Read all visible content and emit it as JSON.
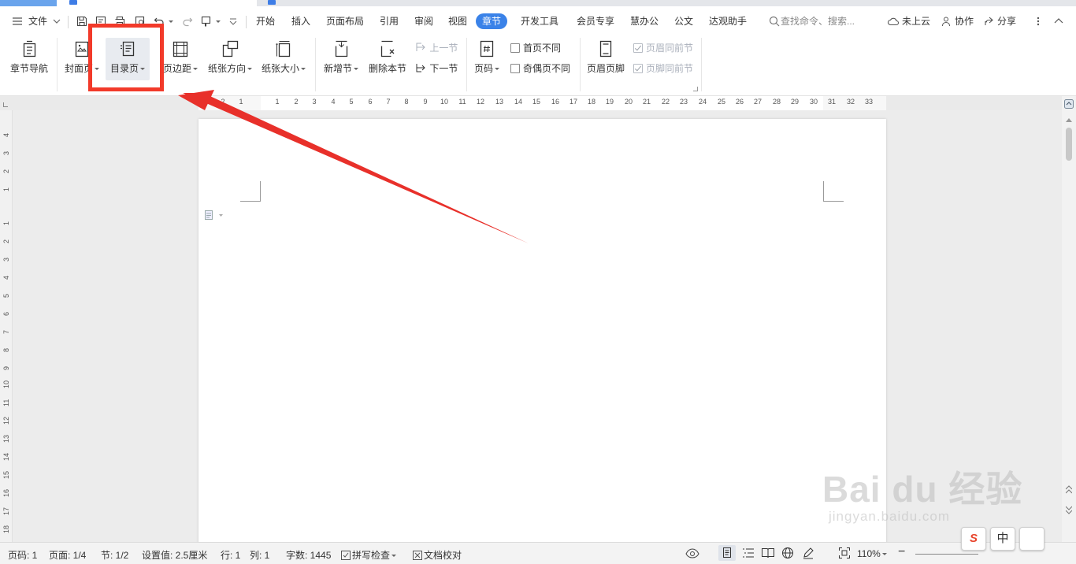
{
  "menubar": {
    "file_label": "文件",
    "tabs": [
      "开始",
      "插入",
      "页面布局",
      "引用",
      "审阅",
      "视图",
      "章节",
      "开发工具",
      "会员专享",
      "慧办公",
      "公文",
      "达观助手"
    ],
    "active_tab": "章节",
    "search_placeholder": "查找命令、搜索...",
    "cloud_label": "未上云",
    "collab_label": "协作",
    "share_label": "分享"
  },
  "ribbon": {
    "nav_label": "章节导航",
    "cover_label": "封面页",
    "toc_label": "目录页",
    "margin_label": "页边距",
    "orientation_label": "纸张方向",
    "size_label": "纸张大小",
    "new_section_label": "新增节",
    "delete_section_label": "删除本节",
    "prev_section_label": "上一节",
    "next_section_label": "下一节",
    "page_number_label": "页码",
    "first_page_diff_label": "首页不同",
    "odd_even_diff_label": "奇偶页不同",
    "header_footer_label": "页眉页脚",
    "header_same_label": "页眉同前节",
    "footer_same_label": "页脚同前节"
  },
  "ruler": {
    "h_ticks": [
      "2",
      "1",
      "1",
      "2",
      "3",
      "4",
      "5",
      "6",
      "7",
      "8",
      "9",
      "10",
      "11",
      "12",
      "13",
      "14",
      "15",
      "16",
      "17",
      "18",
      "19",
      "20",
      "21",
      "22",
      "23",
      "24",
      "25",
      "26",
      "27",
      "28",
      "29",
      "30",
      "31",
      "32",
      "33"
    ],
    "v_ticks": [
      "4",
      "3",
      "2",
      "1",
      "1",
      "2",
      "3",
      "4",
      "5",
      "6",
      "7",
      "8",
      "9",
      "10",
      "11",
      "12",
      "13",
      "14",
      "15",
      "16",
      "17",
      "18"
    ]
  },
  "statusbar": {
    "page_code": "页码: 1",
    "page": "页面: 1/4",
    "section": "节: 1/2",
    "setting": "设置值: 2.5厘米",
    "row": "行: 1",
    "col": "列: 1",
    "word_count": "字数: 1445",
    "spell_check": "拼写检查",
    "doc_proof": "文档校对",
    "zoom": "110%"
  },
  "watermark": {
    "brand": "Bai du 经验",
    "url": "jingyan.baidu.com"
  },
  "ime": {
    "logo": "S",
    "lang": "中"
  },
  "colors": {
    "accent": "#3a82e8",
    "highlight_box": "#f23a2a",
    "arrow": "#e8302a"
  }
}
